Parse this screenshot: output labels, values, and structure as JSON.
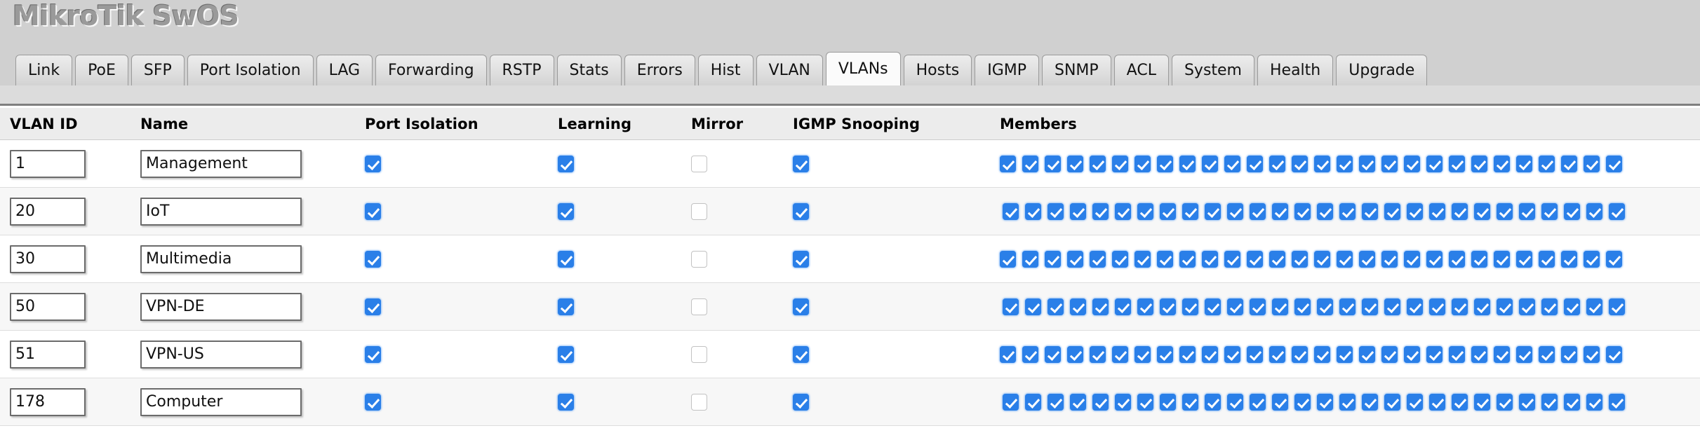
{
  "app": {
    "logo_text": "MikroTik SwOS",
    "brand_color": "#9a9a9a",
    "accent_color": "#2a7fe8"
  },
  "tabs": [
    {
      "label": "Link",
      "active": false
    },
    {
      "label": "PoE",
      "active": false
    },
    {
      "label": "SFP",
      "active": false
    },
    {
      "label": "Port Isolation",
      "active": false
    },
    {
      "label": "LAG",
      "active": false
    },
    {
      "label": "Forwarding",
      "active": false
    },
    {
      "label": "RSTP",
      "active": false
    },
    {
      "label": "Stats",
      "active": false
    },
    {
      "label": "Errors",
      "active": false
    },
    {
      "label": "Hist",
      "active": false
    },
    {
      "label": "VLAN",
      "active": false
    },
    {
      "label": "VLANs",
      "active": true
    },
    {
      "label": "Hosts",
      "active": false
    },
    {
      "label": "IGMP",
      "active": false
    },
    {
      "label": "SNMP",
      "active": false
    },
    {
      "label": "ACL",
      "active": false
    },
    {
      "label": "System",
      "active": false
    },
    {
      "label": "Health",
      "active": false
    },
    {
      "label": "Upgrade",
      "active": false
    }
  ],
  "table": {
    "columns": {
      "vlan_id": "VLAN ID",
      "name": "Name",
      "port_isolation": "Port Isolation",
      "learning": "Learning",
      "mirror": "Mirror",
      "igmp_snooping": "IGMP Snooping",
      "members": "Members"
    },
    "member_port_count": 28,
    "rows": [
      {
        "vlan_id": "1",
        "name": "Management",
        "port_isolation": true,
        "learning": true,
        "mirror": false,
        "igmp_snooping": true,
        "members": [
          true,
          true,
          true,
          true,
          true,
          true,
          true,
          true,
          true,
          true,
          true,
          true,
          true,
          true,
          true,
          true,
          true,
          true,
          true,
          true,
          true,
          true,
          true,
          true,
          true,
          true,
          true,
          true
        ]
      },
      {
        "vlan_id": "20",
        "name": "IoT",
        "port_isolation": true,
        "learning": true,
        "mirror": false,
        "igmp_snooping": true,
        "members": [
          true,
          true,
          true,
          true,
          true,
          true,
          true,
          true,
          true,
          true,
          true,
          true,
          true,
          true,
          true,
          true,
          true,
          true,
          true,
          true,
          true,
          true,
          true,
          true,
          true,
          true,
          true,
          true
        ]
      },
      {
        "vlan_id": "30",
        "name": "Multimedia",
        "port_isolation": true,
        "learning": true,
        "mirror": false,
        "igmp_snooping": true,
        "members": [
          true,
          true,
          true,
          true,
          true,
          true,
          true,
          true,
          true,
          true,
          true,
          true,
          true,
          true,
          true,
          true,
          true,
          true,
          true,
          true,
          true,
          true,
          true,
          true,
          true,
          true,
          true,
          true
        ]
      },
      {
        "vlan_id": "50",
        "name": "VPN-DE",
        "port_isolation": true,
        "learning": true,
        "mirror": false,
        "igmp_snooping": true,
        "members": [
          true,
          true,
          true,
          true,
          true,
          true,
          true,
          true,
          true,
          true,
          true,
          true,
          true,
          true,
          true,
          true,
          true,
          true,
          true,
          true,
          true,
          true,
          true,
          true,
          true,
          true,
          true,
          true
        ]
      },
      {
        "vlan_id": "51",
        "name": "VPN-US",
        "port_isolation": true,
        "learning": true,
        "mirror": false,
        "igmp_snooping": true,
        "members": [
          true,
          true,
          true,
          true,
          true,
          true,
          true,
          true,
          true,
          true,
          true,
          true,
          true,
          true,
          true,
          true,
          true,
          true,
          true,
          true,
          true,
          true,
          true,
          true,
          true,
          true,
          true,
          true
        ]
      },
      {
        "vlan_id": "178",
        "name": "Computer",
        "port_isolation": true,
        "learning": true,
        "mirror": false,
        "igmp_snooping": true,
        "members": [
          true,
          true,
          true,
          true,
          true,
          true,
          true,
          true,
          true,
          true,
          true,
          true,
          true,
          true,
          true,
          true,
          true,
          true,
          true,
          true,
          true,
          true,
          true,
          true,
          true,
          true,
          true,
          true
        ]
      }
    ]
  }
}
